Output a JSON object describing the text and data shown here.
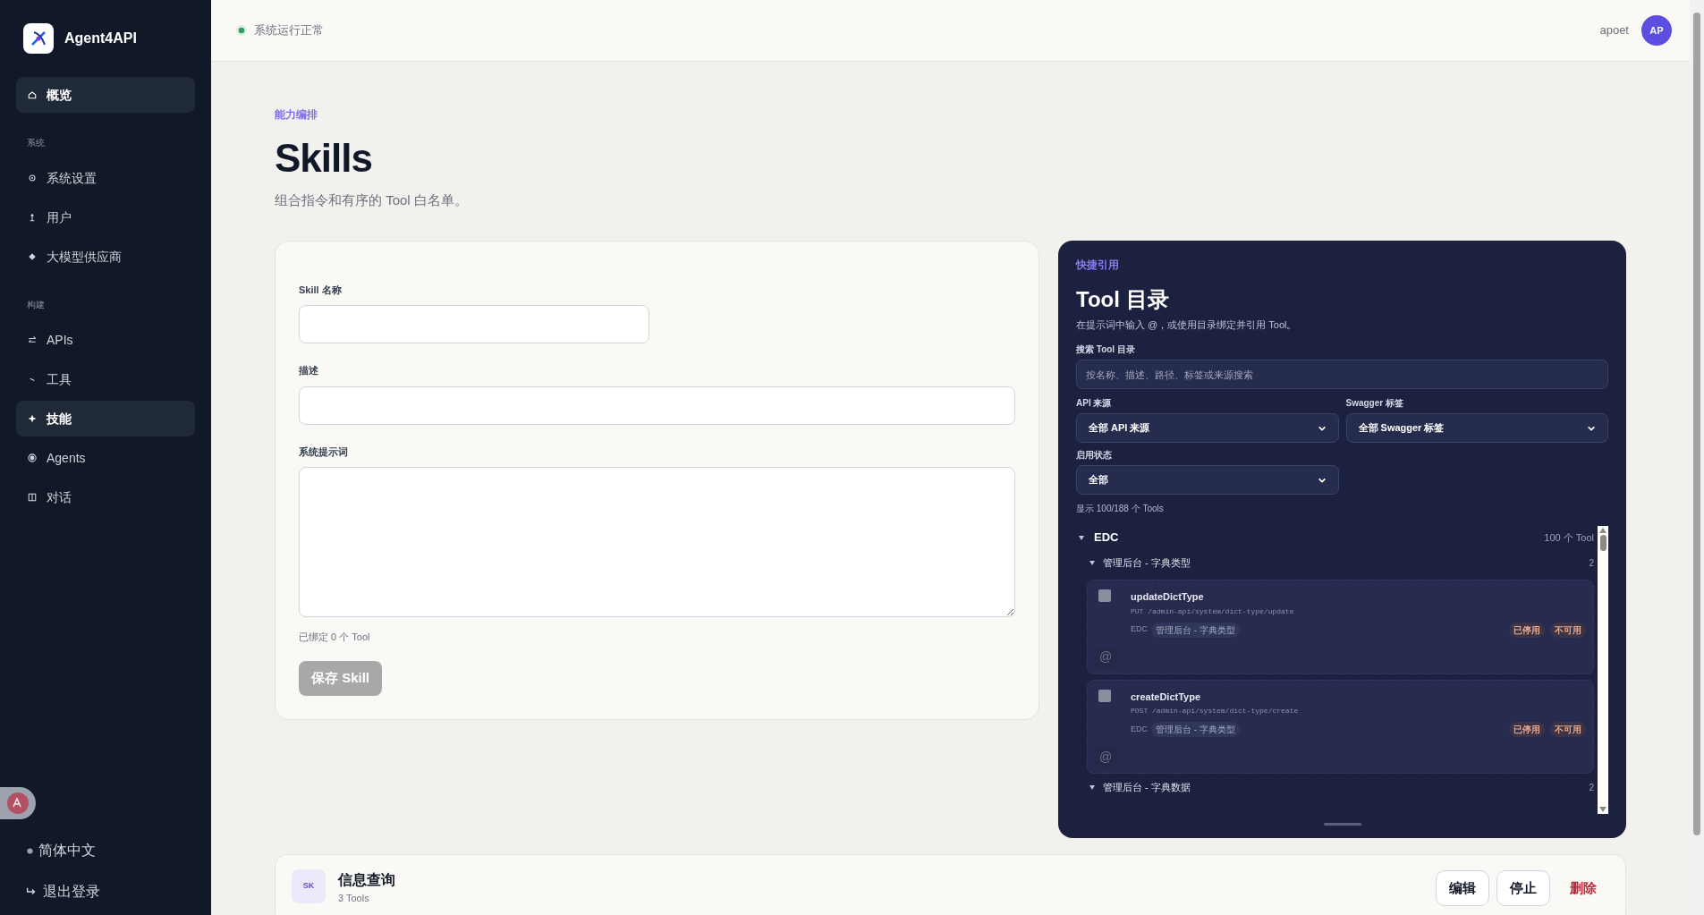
{
  "sidebar": {
    "brand": "Agent4API",
    "items": [
      {
        "kind": "item",
        "label": "概览",
        "selected": true
      },
      {
        "kind": "section",
        "label": "系统"
      },
      {
        "kind": "item",
        "label": "系统设置",
        "selected": false
      },
      {
        "kind": "item",
        "label": "用户",
        "selected": false
      },
      {
        "kind": "item",
        "label": "大模型供应商",
        "selected": false
      },
      {
        "kind": "section",
        "label": "构建"
      },
      {
        "kind": "item",
        "label": "APIs",
        "selected": false
      },
      {
        "kind": "item",
        "label": "工具",
        "selected": false
      },
      {
        "kind": "item",
        "label": "技能",
        "selected": true
      },
      {
        "kind": "item",
        "label": "Agents",
        "selected": false
      },
      {
        "kind": "item",
        "label": "对话",
        "selected": false
      }
    ],
    "language": "简体中文",
    "logout": "退出登录"
  },
  "header": {
    "status": "系统运行正常",
    "user": "apoet",
    "avatar": "AP"
  },
  "page": {
    "eyebrow": "能力编排",
    "title": "Skills",
    "subtitle": "组合指令和有序的 Tool 白名单。"
  },
  "form": {
    "fields": [
      {
        "kind": "input",
        "label": "Skill 名称",
        "wide": false
      },
      {
        "kind": "input",
        "label": "描述",
        "wide": true
      },
      {
        "kind": "textarea",
        "label": "系统提示词",
        "wide": true
      }
    ],
    "bound": "已绑定 0 个 Tool",
    "save": {
      "label": "保存 Skill",
      "disabled": true
    }
  },
  "catalog": {
    "eyebrow": "快捷引用",
    "title": "Tool 目录",
    "subtitle": "在提示词中输入 @，或使用目录绑定并引用 Tool。",
    "search": {
      "label": "搜索 Tool 目录",
      "placeholder": "按名称、描述、路径、标签或来源搜索"
    },
    "filters": [
      {
        "label": "API 来源",
        "value": "全部 API 来源"
      },
      {
        "label": "Swagger 标签",
        "value": "全部 Swagger 标签"
      },
      {
        "label": "启用状态",
        "value": "全部"
      }
    ],
    "shown": "显示 100/188 个 Tools",
    "groups": [
      {
        "name": "EDC",
        "count": "100 个 Tool",
        "expanded": true,
        "children": [
          {
            "name": "管理后台 - 字典类型",
            "count": "2",
            "expanded": true,
            "tools": [
              {
                "name": "updateDictType",
                "method": "PUT",
                "path": "/admin-api/system/dict-type/update",
                "source": "EDC",
                "tag": "管理后台 - 字典类型",
                "badges": [
                  "已停用",
                  "不可用"
                ],
                "checked": false,
                "mention": "@"
              },
              {
                "name": "createDictType",
                "method": "POST",
                "path": "/admin-api/system/dict-type/create",
                "source": "EDC",
                "tag": "管理后台 - 字典类型",
                "badges": [
                  "已停用",
                  "不可用"
                ],
                "checked": false,
                "mention": "@"
              }
            ]
          },
          {
            "name": "管理后台 - 字典数据",
            "count": "2",
            "expanded": true
          }
        ]
      }
    ]
  },
  "skills": [
    {
      "abbr": "SK",
      "name": "信息查询",
      "count": "3 Tools",
      "actions": [
        {
          "kind": "outline",
          "label": "编辑"
        },
        {
          "kind": "outline",
          "label": "停止"
        },
        {
          "kind": "danger",
          "label": "删除"
        }
      ]
    }
  ]
}
